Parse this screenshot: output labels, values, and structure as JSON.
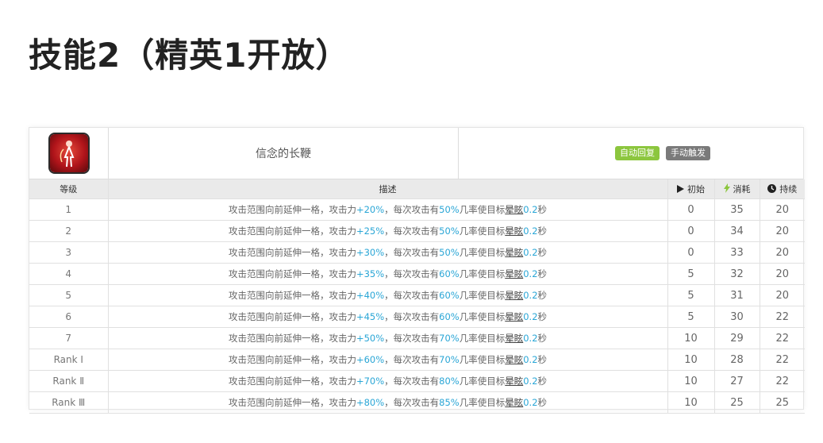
{
  "title": "技能2（精英1开放）",
  "skill": {
    "icon": "red-figure-icon",
    "name": "信念的长鞭",
    "tags": [
      "自动回复",
      "手动触发"
    ]
  },
  "columns": {
    "level": "等级",
    "description": "描述",
    "initial": "初始",
    "cost": "消耗",
    "duration": "持续"
  },
  "colors": {
    "highlight": "#2aa6d6",
    "tag_green": "#8cc63e",
    "tag_gray": "#7a7a7a"
  },
  "desc_parts": {
    "prefix": "攻击范围向前延伸一格，攻击力",
    "mid": "，每次攻击有",
    "mid2": "几率使目标",
    "status": "晕眩",
    "sec": "秒"
  },
  "rows": [
    {
      "level": "1",
      "atk": "+20%",
      "chance": "50%",
      "stun": "0.2",
      "initial": "0",
      "cost": "35",
      "duration": "20"
    },
    {
      "level": "2",
      "atk": "+25%",
      "chance": "50%",
      "stun": "0.2",
      "initial": "0",
      "cost": "34",
      "duration": "20"
    },
    {
      "level": "3",
      "atk": "+30%",
      "chance": "50%",
      "stun": "0.2",
      "initial": "0",
      "cost": "33",
      "duration": "20"
    },
    {
      "level": "4",
      "atk": "+35%",
      "chance": "60%",
      "stun": "0.2",
      "initial": "5",
      "cost": "32",
      "duration": "20"
    },
    {
      "level": "5",
      "atk": "+40%",
      "chance": "60%",
      "stun": "0.2",
      "initial": "5",
      "cost": "31",
      "duration": "20"
    },
    {
      "level": "6",
      "atk": "+45%",
      "chance": "60%",
      "stun": "0.2",
      "initial": "5",
      "cost": "30",
      "duration": "22"
    },
    {
      "level": "7",
      "atk": "+50%",
      "chance": "70%",
      "stun": "0.2",
      "initial": "10",
      "cost": "29",
      "duration": "22"
    },
    {
      "level": "Rank Ⅰ",
      "atk": "+60%",
      "chance": "70%",
      "stun": "0.2",
      "initial": "10",
      "cost": "28",
      "duration": "22"
    },
    {
      "level": "Rank Ⅱ",
      "atk": "+70%",
      "chance": "80%",
      "stun": "0.2",
      "initial": "10",
      "cost": "27",
      "duration": "22"
    },
    {
      "level": "Rank Ⅲ",
      "atk": "+80%",
      "chance": "85%",
      "stun": "0.2",
      "initial": "10",
      "cost": "25",
      "duration": "25"
    }
  ]
}
